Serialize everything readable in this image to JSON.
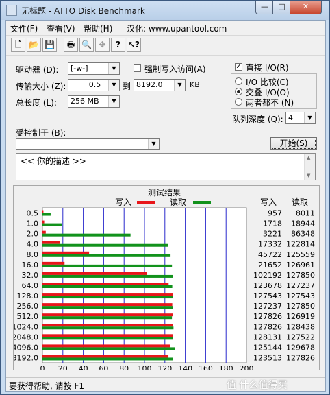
{
  "window": {
    "title": "无标题 - ATTO Disk Benchmark",
    "min_label": "—",
    "max_label": "□",
    "close_label": "✕"
  },
  "menu": {
    "file": "文件(F)",
    "view": "查看(V)",
    "help": "帮助(H)",
    "localized": "汉化: www.upantool.com"
  },
  "toolbar": {
    "icons": [
      "new-icon",
      "open-icon",
      "save-icon",
      "print-icon",
      "print-preview-icon",
      "move-icon",
      "about-icon",
      "context-help-icon"
    ]
  },
  "form": {
    "drive_label": "驱动器 (D):",
    "drive_value": "[-w-]",
    "force_write_label": "强制写入访问(A)",
    "force_write_checked": false,
    "transfer_size_label": "传输大小 (Z):",
    "transfer_from": "0.5",
    "transfer_to_label": "到",
    "transfer_to": "8192.0",
    "transfer_unit": "KB",
    "total_length_label": "总长度 (L):",
    "total_length_value": "256 MB",
    "direct_io_label": "直接 I/O(R)",
    "direct_io_checked": true,
    "io_compare_label": "I/O 比较(C)",
    "io_overlap_label": "交叠 I/O(O)",
    "neither_label": "两者都不 (N)",
    "io_mode_selected": "交叠 I/O(O)",
    "queue_depth_label": "队列深度 (Q):",
    "queue_depth_value": "4",
    "controlled_by_label": "受控制于 (B):",
    "controlled_by_value": "",
    "start_button": "开始(S)",
    "description": "<<   你的描述   >>"
  },
  "results": {
    "title": "测试结果",
    "legend_write": "写入",
    "legend_read": "读取",
    "col_write": "写入",
    "col_read": "读取",
    "rows": [
      {
        "size": "0.5",
        "write": "957",
        "read": "8011"
      },
      {
        "size": "1.0",
        "write": "1718",
        "read": "18944"
      },
      {
        "size": "2.0",
        "write": "3221",
        "read": "86348"
      },
      {
        "size": "4.0",
        "write": "17332",
        "read": "122814"
      },
      {
        "size": "8.0",
        "write": "45722",
        "read": "125559"
      },
      {
        "size": "16.0",
        "write": "21652",
        "read": "126961"
      },
      {
        "size": "32.0",
        "write": "102192",
        "read": "127850"
      },
      {
        "size": "64.0",
        "write": "123678",
        "read": "127237"
      },
      {
        "size": "128.0",
        "write": "127543",
        "read": "127543"
      },
      {
        "size": "256.0",
        "write": "127237",
        "read": "127850"
      },
      {
        "size": "512.0",
        "write": "127826",
        "read": "126919"
      },
      {
        "size": "1024.0",
        "write": "127826",
        "read": "128438"
      },
      {
        "size": "2048.0",
        "write": "128131",
        "read": "127522"
      },
      {
        "size": "4096.0",
        "write": "125144",
        "read": "129678"
      },
      {
        "size": "8192.0",
        "write": "123513",
        "read": "127826"
      }
    ],
    "x_ticks": [
      "0",
      "20",
      "40",
      "60",
      "80",
      "100",
      "120",
      "140",
      "160",
      "180",
      "200"
    ],
    "x_label": "传输速率 - MB / 秒"
  },
  "chart_data": {
    "type": "bar",
    "title": "测试结果",
    "categories": [
      "0.5",
      "1.0",
      "2.0",
      "4.0",
      "8.0",
      "16.0",
      "32.0",
      "64.0",
      "128.0",
      "256.0",
      "512.0",
      "1024.0",
      "2048.0",
      "4096.0",
      "8192.0"
    ],
    "series": [
      {
        "name": "写入",
        "color": "#e8161a",
        "values": [
          0.957,
          1.718,
          3.221,
          17.332,
          45.722,
          21.652,
          102.192,
          123.678,
          127.543,
          127.237,
          127.826,
          127.826,
          128.131,
          125.144,
          123.513
        ]
      },
      {
        "name": "读取",
        "color": "#12921c",
        "values": [
          8.011,
          18.944,
          86.348,
          122.814,
          125.559,
          126.961,
          127.85,
          127.237,
          127.543,
          127.85,
          126.919,
          128.438,
          127.522,
          129.678,
          127.826
        ]
      }
    ],
    "xlabel": "传输速率 - MB / 秒",
    "xlim": [
      0,
      200
    ],
    "orientation": "horizontal",
    "grid": true,
    "legend": "top"
  },
  "status": {
    "text": "要获得帮助, 请按 F1",
    "watermark": "值 什么值得买"
  }
}
